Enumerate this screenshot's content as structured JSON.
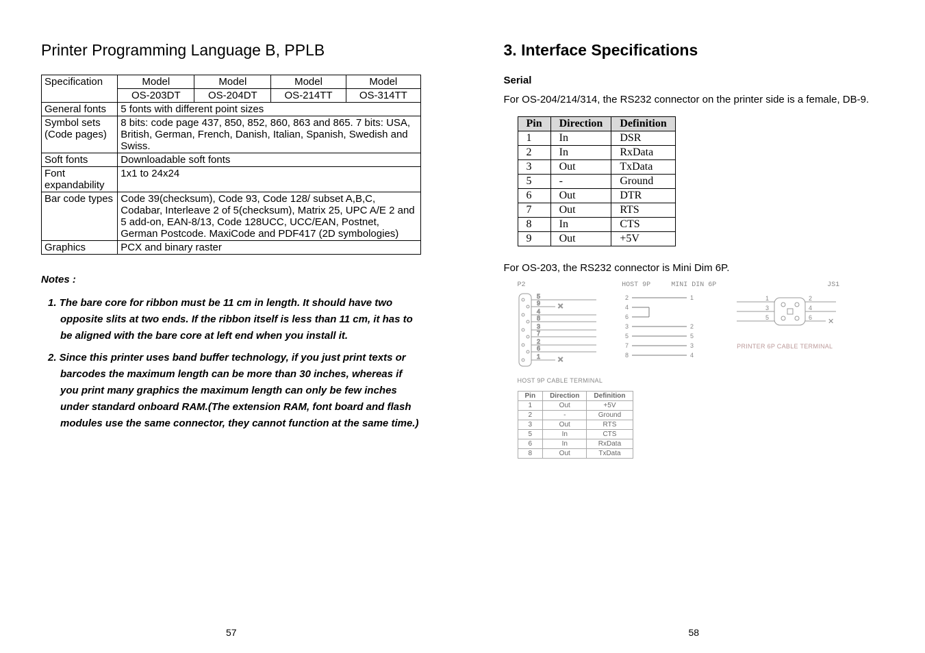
{
  "left": {
    "title": "Printer Programming Language B, PPLB",
    "table": {
      "header": [
        "Specification",
        "Model",
        "Model",
        "Model",
        "Model"
      ],
      "sub": [
        "",
        "OS-203DT",
        "OS-204DT",
        "OS-214TT",
        "OS-314TT"
      ],
      "rows": [
        {
          "label": "General fonts",
          "value": "5 fonts with different point sizes"
        },
        {
          "label": "Symbol sets (Code pages)",
          "value": "8 bits: code page 437, 850, 852, 860, 863 and 865. 7 bits: USA, British, German, French, Danish, Italian, Spanish, Swedish and Swiss."
        },
        {
          "label": "Soft fonts",
          "value": "Downloadable soft fonts"
        },
        {
          "label": "Font expandability",
          "value": "1x1 to 24x24"
        },
        {
          "label": "Bar code types",
          "value": "Code 39(checksum), Code 93, Code 128/ subset A,B,C, Codabar, Interleave 2 of 5(checksum), Matrix 25, UPC A/E 2 and 5 add-on, EAN-8/13, Code 128UCC, UCC/EAN, Postnet, German Postcode. MaxiCode and PDF417 (2D symbologies)"
        },
        {
          "label": "Graphics",
          "value": "PCX and binary raster"
        }
      ]
    },
    "notes_label": "Notes :",
    "notes": [
      "1. The bare core for ribbon must be 11 cm in length. It should have two opposite slits at two ends. If the ribbon itself is less than 11 cm, it has to be aligned with the bare core at left end when you install it.",
      "2. Since this printer uses band buffer technology, if you just print texts or barcodes the maximum length can be more than 30 inches, whereas if you print many graphics the maximum length can only be few inches under standard onboard RAM.(The extension RAM, font board and flash modules use the same connector, they cannot function at the same time.)"
    ],
    "page": "57"
  },
  "right": {
    "title": "3. Interface Specifications",
    "serial_label": "Serial",
    "lead": "For OS-204/214/314, the RS232 connector on the printer side is a female, DB-9.",
    "pin_header": [
      "Pin",
      "Direction",
      "Definition"
    ],
    "pins": [
      {
        "pin": "1",
        "dir": "In",
        "def": "DSR"
      },
      {
        "pin": "2",
        "dir": "In",
        "def": "RxData"
      },
      {
        "pin": "3",
        "dir": "Out",
        "def": "TxData"
      },
      {
        "pin": "5",
        "dir": "-",
        "def": "Ground"
      },
      {
        "pin": "6",
        "dir": "Out",
        "def": "DTR"
      },
      {
        "pin": "7",
        "dir": "Out",
        "def": "RTS"
      },
      {
        "pin": "8",
        "dir": "In",
        "def": "CTS"
      },
      {
        "pin": "9",
        "dir": "Out",
        "def": "+5V"
      }
    ],
    "mini_lead": "For OS-203, the RS232 connector is Mini Dim 6P.",
    "diagram": {
      "p2_label": "P2",
      "p2_pins": [
        "5",
        "9",
        "4",
        "8",
        "3",
        "7",
        "2",
        "6",
        "1"
      ],
      "host9p_label": "HOST 9P",
      "minidin_label": "MINI DIN 6P",
      "map": [
        {
          "l": "2",
          "r": "1"
        },
        {
          "l": "4",
          "r": ""
        },
        {
          "l": "6",
          "r": ""
        },
        {
          "l": "3",
          "r": "2"
        },
        {
          "l": "5",
          "r": "5"
        },
        {
          "l": "7",
          "r": "3"
        },
        {
          "l": "8",
          "r": "4"
        }
      ],
      "js1_label": "JS1",
      "js1_left": [
        "1",
        "3",
        "5"
      ],
      "js1_right": [
        "2",
        "4",
        "6"
      ],
      "printer_caption": "PRINTER 6P CABLE TERMINAL",
      "host_caption": "HOST 9P CABLE TERMINAL"
    },
    "mini_header": [
      "Pin",
      "Direction",
      "Definition"
    ],
    "mini_rows": [
      {
        "pin": "1",
        "dir": "Out",
        "def": "+5V"
      },
      {
        "pin": "2",
        "dir": "-",
        "def": "Ground"
      },
      {
        "pin": "3",
        "dir": "Out",
        "def": "RTS"
      },
      {
        "pin": "5",
        "dir": "In",
        "def": "CTS"
      },
      {
        "pin": "6",
        "dir": "In",
        "def": "RxData"
      },
      {
        "pin": "8",
        "dir": "Out",
        "def": "TxData"
      }
    ],
    "page": "58"
  }
}
